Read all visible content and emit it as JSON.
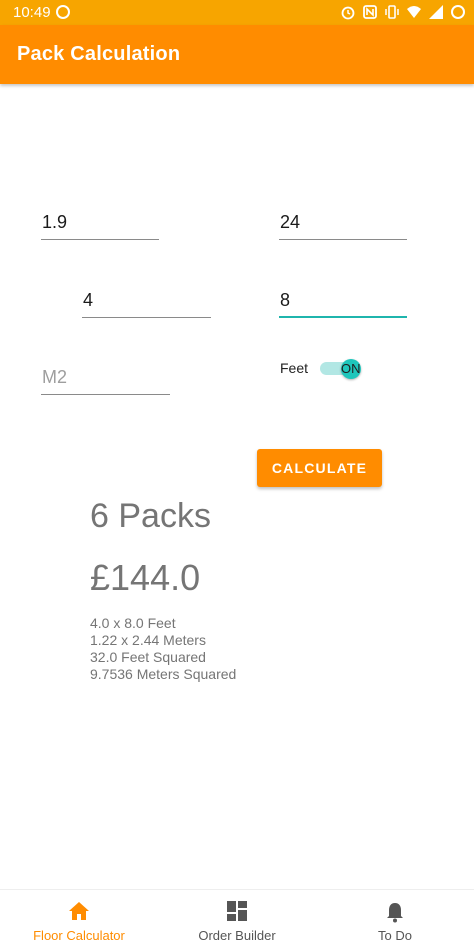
{
  "status_bar": {
    "time": "10:49"
  },
  "app_bar": {
    "title": "Pack Calculation",
    "color": "#ff8c00"
  },
  "inputs": {
    "width_value": "1.9",
    "price_value": "24",
    "length_value": "4",
    "height_value": "8",
    "area_placeholder": "M2"
  },
  "toggle": {
    "label": "Feet",
    "state_text": "ON",
    "checked": true
  },
  "calculate_button": {
    "label": "CALCULATE"
  },
  "result": {
    "packs": "6 Packs",
    "price": "£144.0",
    "line1": "4.0 x 8.0 Feet",
    "line2": "1.22 x 2.44 Meters",
    "line3": "32.0 Feet Squared",
    "line4": "9.7536 Meters Squared"
  },
  "bottom_nav": {
    "items": [
      {
        "label": "Floor Calculator",
        "icon": "home-icon",
        "active": true
      },
      {
        "label": "Order Builder",
        "icon": "dashboard-icon",
        "active": false
      },
      {
        "label": "To Do",
        "icon": "bell-icon",
        "active": false
      }
    ]
  }
}
